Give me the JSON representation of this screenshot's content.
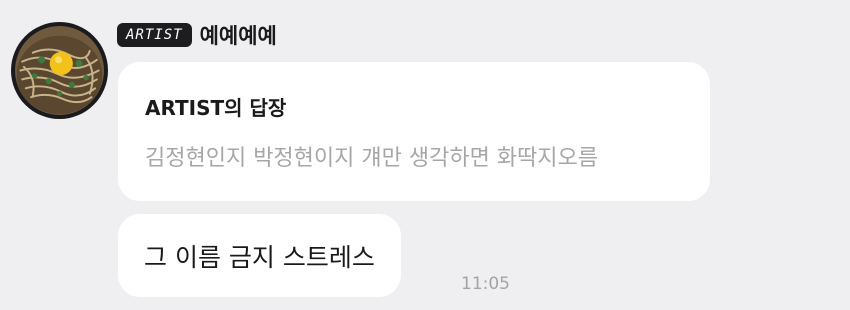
{
  "sender": {
    "role_badge": "ARTIST",
    "name": "예예예예"
  },
  "reply": {
    "title": "ARTIST의 답장",
    "quoted_text": "김정현인지 박정현이지 걔만 생각하면 화딱지오름"
  },
  "message": {
    "text": "그 이름 금지 스트레스",
    "time": "11:05"
  },
  "icons": {
    "avatar": "profile-photo-noodle-bowl"
  },
  "colors": {
    "background": "#efeff1",
    "bubble": "#ffffff",
    "badge": "#1d1d20",
    "muted_text": "#a6a6a8"
  }
}
